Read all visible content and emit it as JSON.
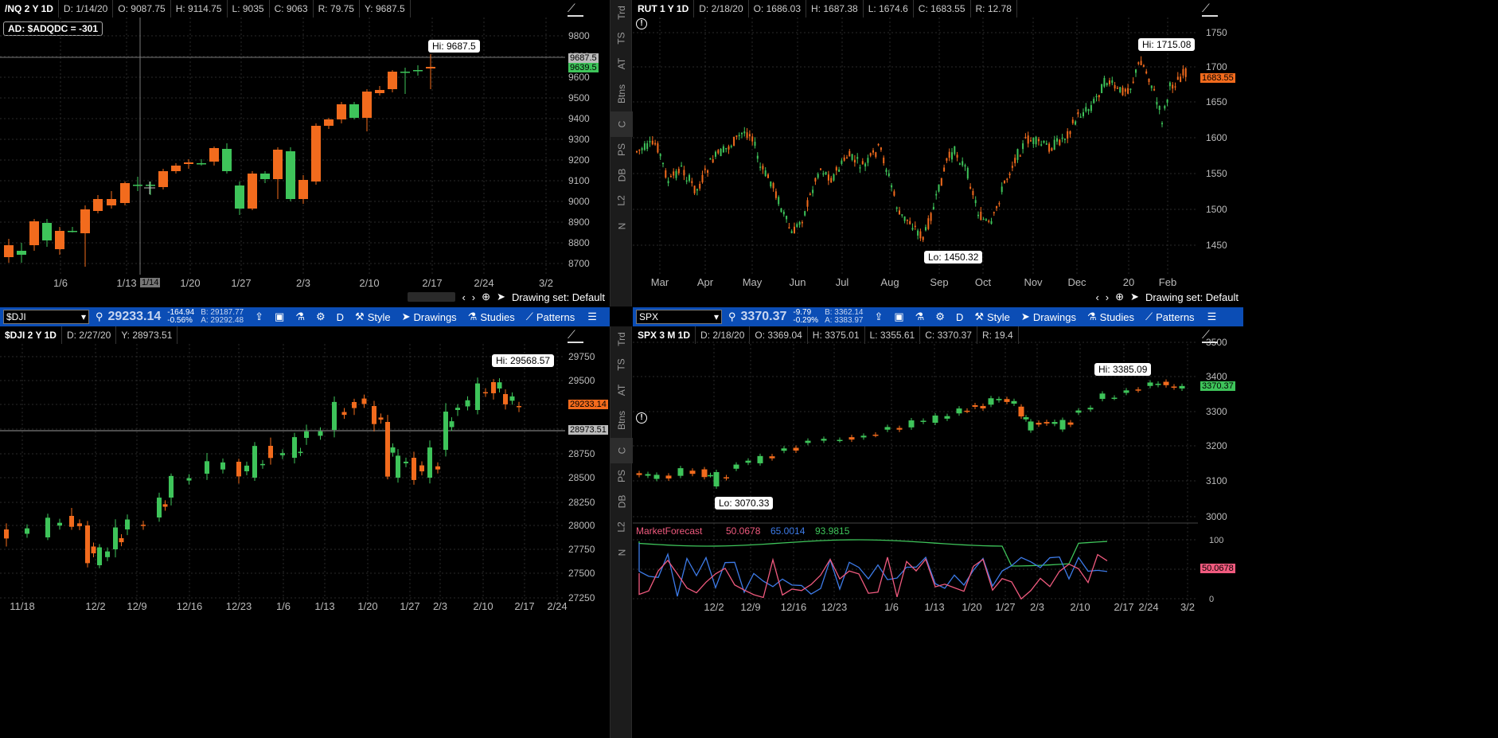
{
  "nq_panel": {
    "info": [
      "/NQ 2 Y 1D",
      "D: 1/14/20",
      "O: 9087.75",
      "H: 9114.75",
      "L: 9035",
      "C: 9063",
      "R: 79.75",
      "Y: 9687.5"
    ],
    "ad_label": "AD: $ADQDC = -301",
    "hi_label": "Hi: 9687.5",
    "price_tag_1": "9687.5",
    "price_tag_2": "9639.5",
    "crosshair_date": "1/14",
    "y_ticks": [
      "9800",
      "9700",
      "9600",
      "9500",
      "9400",
      "9300",
      "9200",
      "9100",
      "9000",
      "8900",
      "8800",
      "8700"
    ],
    "x_ticks": [
      "1/6",
      "1/13",
      "1/20",
      "1/27",
      "2/3",
      "2/10",
      "2/17",
      "2/24",
      "3/2"
    ],
    "drawing_set": "Drawing set: Default"
  },
  "rut_panel": {
    "info": [
      "RUT 1 Y 1D",
      "D: 2/18/20",
      "O: 1686.03",
      "H: 1687.38",
      "L: 1674.6",
      "C: 1683.55",
      "R: 12.78"
    ],
    "hi_label": "Hi: 1715.08",
    "lo_label": "Lo: 1450.32",
    "price_tag": "1683.55",
    "y_ticks": [
      "1750",
      "1700",
      "1650",
      "1600",
      "1550",
      "1500",
      "1450"
    ],
    "x_ticks": [
      "Mar",
      "Apr",
      "May",
      "Jun",
      "Jul",
      "Aug",
      "Sep",
      "Oct",
      "Nov",
      "Dec",
      "20",
      "Feb"
    ],
    "drawing_set": "Drawing set: Default"
  },
  "sidebar_tabs": [
    "Trd",
    "TS",
    "AT",
    "Btns",
    "C",
    "PS",
    "DB",
    "L2",
    "N"
  ],
  "dji_toolbar": {
    "symbol": "$DJI",
    "price": "29233.14",
    "change": "-164.94",
    "change_pct": "-0.56%",
    "bid": "B: 29187.77",
    "ask": "A: 29292.48",
    "period": "D",
    "style": "Style",
    "drawings": "Drawings",
    "studies": "Studies",
    "patterns": "Patterns"
  },
  "spx_toolbar": {
    "symbol": "SPX",
    "price": "3370.37",
    "change": "-9.79",
    "change_pct": "-0.29%",
    "bid": "B: 3362.14",
    "ask": "A: 3383.97",
    "period": "D",
    "style": "Style",
    "drawings": "Drawings",
    "studies": "Studies",
    "patterns": "Patterns"
  },
  "dji_panel": {
    "info": [
      "$DJI 2 Y 1D",
      "D: 2/27/20",
      "Y: 28973.51"
    ],
    "hi_label": "Hi: 29568.57",
    "price_tag_1": "29233.14",
    "price_tag_2": "28973.51",
    "y_ticks": [
      "29750",
      "29500",
      "29250",
      "29000",
      "28750",
      "28500",
      "28250",
      "28000",
      "27750",
      "27500",
      "27250"
    ],
    "x_ticks": [
      "11/18",
      "12/2",
      "12/9",
      "12/16",
      "12/23",
      "1/6",
      "1/13",
      "1/20",
      "1/27",
      "2/3",
      "2/10",
      "2/17",
      "2/24"
    ]
  },
  "spx_panel": {
    "info": [
      "SPX 3 M 1D",
      "D: 2/18/20",
      "O: 3369.04",
      "H: 3375.01",
      "L: 3355.61",
      "C: 3370.37",
      "R: 19.4"
    ],
    "hi_label": "Hi: 3385.09",
    "lo_label": "Lo: 3070.33",
    "price_tag": "3370.37",
    "y_ticks": [
      "3500",
      "3400",
      "3300",
      "3200",
      "3100",
      "3000"
    ],
    "mf_name": "MarketForecast",
    "mf_v1": "50.0678",
    "mf_v2": "65.0014",
    "mf_v3": "93.9815",
    "mf_ticks": [
      "100",
      "50",
      "0"
    ],
    "mf_tag": "50.0678",
    "x_ticks": [
      "12/2",
      "12/9",
      "12/16",
      "12/23",
      "1/6",
      "1/13",
      "1/20",
      "1/27",
      "2/3",
      "2/10",
      "2/17",
      "2/24",
      "3/2"
    ]
  },
  "colors": {
    "up": "#3ec45a",
    "down": "#f26b1d",
    "toolbar": "#0b4db5",
    "grid": "#333333"
  }
}
